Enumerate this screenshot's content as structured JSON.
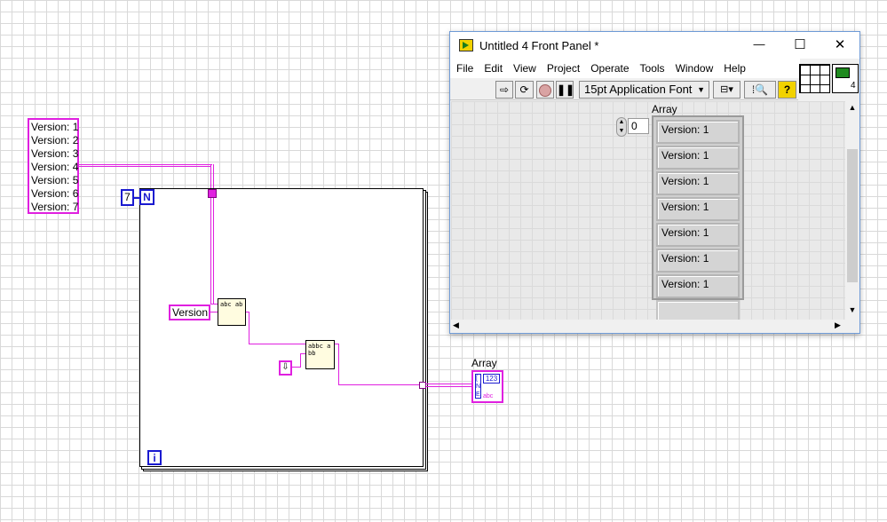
{
  "block_diagram": {
    "version_list": [
      "Version: 1",
      "Version: 2",
      "Version: 3",
      "Version: 4",
      "Version: 5",
      "Version: 6",
      "Version: 7"
    ],
    "loop_count": "7",
    "loop_count_terminal": "N",
    "iteration_terminal": "i",
    "search_string_constant": "Version",
    "output_indicator_label": "Array",
    "output_indicator_type": "123",
    "func1_icon_text": "abc ab",
    "func2_icon_text": "abbc a bb"
  },
  "window": {
    "title": "Untitled 4 Front Panel *",
    "controls": {
      "minimize": "—",
      "maximize": "☐",
      "close": "✕"
    },
    "menu": [
      "File",
      "Edit",
      "View",
      "Project",
      "Operate",
      "Tools",
      "Window",
      "Help"
    ],
    "toolbar": {
      "font_selector": "15pt Application Font",
      "help": "?"
    },
    "connector_pane_number": "4",
    "array_label": "Array",
    "array_index": "0",
    "array_values": [
      "Version: 1",
      "Version: 1",
      "Version: 1",
      "Version: 1",
      "Version: 1",
      "Version: 1",
      "Version: 1"
    ]
  },
  "colors": {
    "string_wire": "#e020e0",
    "numeric_blue": "#1a1ad0",
    "window_border": "#6e9ad6"
  }
}
